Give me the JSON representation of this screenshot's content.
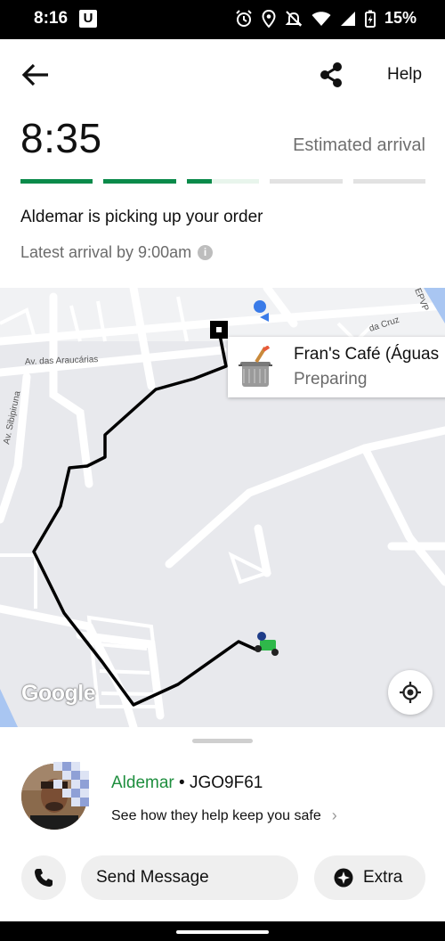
{
  "status_bar": {
    "time": "8:16",
    "app_badge": "U",
    "battery": "15%"
  },
  "header": {
    "help_label": "Help"
  },
  "eta": {
    "time": "8:35",
    "label": "Estimated arrival",
    "progress_segments": [
      1.0,
      1.0,
      0.35,
      0.0,
      0.0
    ],
    "progress_color": "#0a8a4a"
  },
  "order": {
    "status_message": "Aldemar is picking up your order",
    "latest_arrival": "Latest arrival by 9:00am"
  },
  "map": {
    "street_labels": [
      "Av. das Araucárias",
      "Av. Sibipiruna",
      "da Cruz",
      "EPVP"
    ],
    "place_name": "Fran's Café (Águas",
    "place_status": "Preparing",
    "attribution": "Google"
  },
  "driver": {
    "name": "Aldemar",
    "separator": " • ",
    "plate": "JGO9F61",
    "safety_link": "See how they help keep you safe"
  },
  "actions": {
    "message_label": "Send Message",
    "extra_label": "Extra"
  }
}
